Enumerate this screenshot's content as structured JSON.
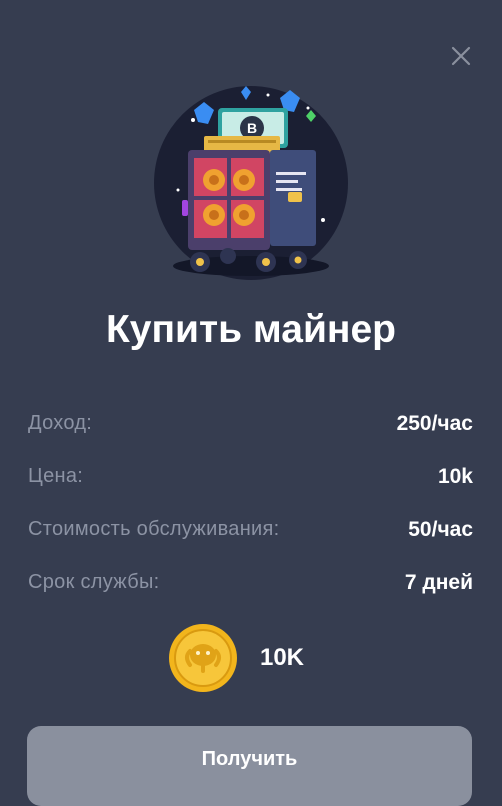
{
  "modal": {
    "title": "Купить майнер",
    "close_icon": "close-icon",
    "illustration": "crypto-miner-rig-illustration"
  },
  "details": [
    {
      "label": "Доход:",
      "value": "250/час"
    },
    {
      "label": "Цена:",
      "value": "10k"
    },
    {
      "label": "Стоимость обслуживания:",
      "value": "50/час"
    },
    {
      "label": "Срок службы:",
      "value": "7 дней"
    }
  ],
  "price": {
    "icon": "gold-coin-icon",
    "amount": "10K"
  },
  "action": {
    "label": "Получить"
  },
  "colors": {
    "background": "#363d50",
    "label_text": "#8c93a4",
    "button": "#8a909e",
    "coin": "#f2b51c"
  }
}
